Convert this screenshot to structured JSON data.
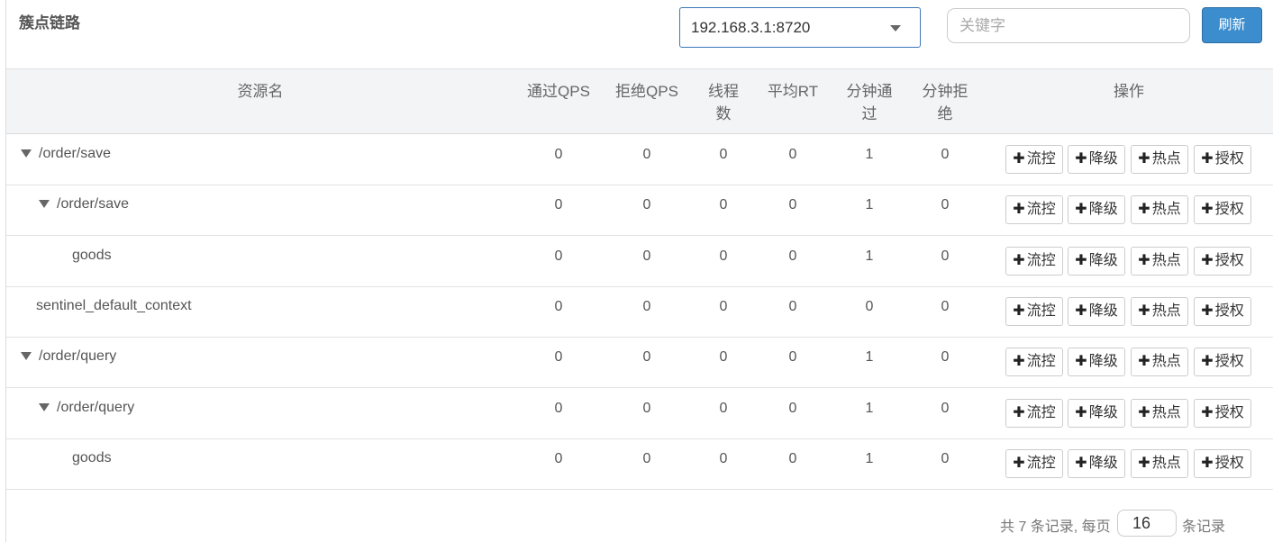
{
  "header": {
    "title": "簇点链路",
    "machine_select": {
      "value": "192.168.3.1:8720"
    },
    "search": {
      "placeholder": "关键字",
      "value": ""
    },
    "refresh_label": "刷新"
  },
  "table": {
    "columns": {
      "resource": "资源名",
      "pass_qps": "通过QPS",
      "block_qps": "拒绝QPS",
      "threads_line1": "线程",
      "threads_line2": "数",
      "avg_rt": "平均RT",
      "minute_pass_line1": "分钟通",
      "minute_pass_line2": "过",
      "minute_block_line1": "分钟拒",
      "minute_block_line2": "绝",
      "ops": "操作"
    },
    "op_labels": {
      "flow": "流控",
      "degrade": "降级",
      "hotspot": "热点",
      "auth": "授权"
    },
    "rows": [
      {
        "name": "/order/save",
        "level": 0,
        "expandable": true,
        "pass_qps": "0",
        "block_qps": "0",
        "threads": "0",
        "avg_rt": "0",
        "minute_pass": "1",
        "minute_block": "0"
      },
      {
        "name": "/order/save",
        "level": 1,
        "expandable": true,
        "pass_qps": "0",
        "block_qps": "0",
        "threads": "0",
        "avg_rt": "0",
        "minute_pass": "1",
        "minute_block": "0"
      },
      {
        "name": "goods",
        "level": 2,
        "expandable": false,
        "pass_qps": "0",
        "block_qps": "0",
        "threads": "0",
        "avg_rt": "0",
        "minute_pass": "1",
        "minute_block": "0"
      },
      {
        "name": "sentinel_default_context",
        "level": 0,
        "expandable": false,
        "pass_qps": "0",
        "block_qps": "0",
        "threads": "0",
        "avg_rt": "0",
        "minute_pass": "0",
        "minute_block": "0"
      },
      {
        "name": "/order/query",
        "level": 0,
        "expandable": true,
        "pass_qps": "0",
        "block_qps": "0",
        "threads": "0",
        "avg_rt": "0",
        "minute_pass": "1",
        "minute_block": "0"
      },
      {
        "name": "/order/query",
        "level": 1,
        "expandable": true,
        "pass_qps": "0",
        "block_qps": "0",
        "threads": "0",
        "avg_rt": "0",
        "minute_pass": "1",
        "minute_block": "0"
      },
      {
        "name": "goods",
        "level": 2,
        "expandable": false,
        "pass_qps": "0",
        "block_qps": "0",
        "threads": "0",
        "avg_rt": "0",
        "minute_pass": "1",
        "minute_block": "0"
      }
    ]
  },
  "pagination": {
    "total_text": "共 7 条记录, 每页",
    "page_size": "16",
    "suffix_text": "条记录"
  }
}
